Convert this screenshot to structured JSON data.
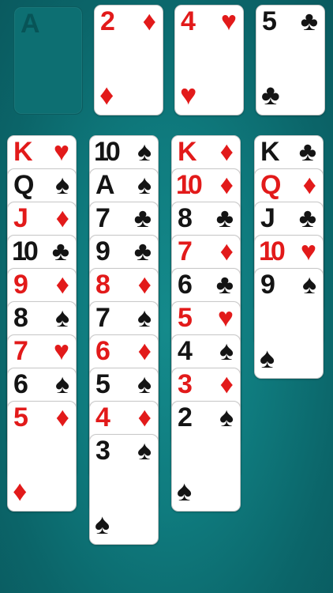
{
  "free_slot": {
    "label": "A"
  },
  "foundations": [
    {
      "rank": "2",
      "suit": "♦",
      "color": "red"
    },
    {
      "rank": "4",
      "suit": "♥",
      "color": "red"
    },
    {
      "rank": "5",
      "suit": "♣",
      "color": "black"
    }
  ],
  "columns": [
    [
      {
        "rank": "K",
        "suit": "♥",
        "color": "red"
      },
      {
        "rank": "Q",
        "suit": "♠",
        "color": "black"
      },
      {
        "rank": "J",
        "suit": "♦",
        "color": "red"
      },
      {
        "rank": "10",
        "suit": "♣",
        "color": "black"
      },
      {
        "rank": "9",
        "suit": "♦",
        "color": "red"
      },
      {
        "rank": "8",
        "suit": "♠",
        "color": "black"
      },
      {
        "rank": "7",
        "suit": "♥",
        "color": "red"
      },
      {
        "rank": "6",
        "suit": "♠",
        "color": "black"
      },
      {
        "rank": "5",
        "suit": "♦",
        "color": "red"
      }
    ],
    [
      {
        "rank": "10",
        "suit": "♠",
        "color": "black"
      },
      {
        "rank": "A",
        "suit": "♠",
        "color": "black"
      },
      {
        "rank": "7",
        "suit": "♣",
        "color": "black"
      },
      {
        "rank": "9",
        "suit": "♣",
        "color": "black"
      },
      {
        "rank": "8",
        "suit": "♦",
        "color": "red"
      },
      {
        "rank": "7",
        "suit": "♠",
        "color": "black"
      },
      {
        "rank": "6",
        "suit": "♦",
        "color": "red"
      },
      {
        "rank": "5",
        "suit": "♠",
        "color": "black"
      },
      {
        "rank": "4",
        "suit": "♦",
        "color": "red"
      },
      {
        "rank": "3",
        "suit": "♠",
        "color": "black"
      }
    ],
    [
      {
        "rank": "K",
        "suit": "♦",
        "color": "red"
      },
      {
        "rank": "10",
        "suit": "♦",
        "color": "red"
      },
      {
        "rank": "8",
        "suit": "♣",
        "color": "black"
      },
      {
        "rank": "7",
        "suit": "♦",
        "color": "red"
      },
      {
        "rank": "6",
        "suit": "♣",
        "color": "black"
      },
      {
        "rank": "5",
        "suit": "♥",
        "color": "red"
      },
      {
        "rank": "4",
        "suit": "♠",
        "color": "black"
      },
      {
        "rank": "3",
        "suit": "♦",
        "color": "red"
      },
      {
        "rank": "2",
        "suit": "♠",
        "color": "black"
      }
    ],
    [
      {
        "rank": "K",
        "suit": "♣",
        "color": "black"
      },
      {
        "rank": "Q",
        "suit": "♦",
        "color": "red"
      },
      {
        "rank": "J",
        "suit": "♣",
        "color": "black"
      },
      {
        "rank": "10",
        "suit": "♥",
        "color": "red"
      },
      {
        "rank": "9",
        "suit": "♠",
        "color": "black"
      }
    ]
  ]
}
